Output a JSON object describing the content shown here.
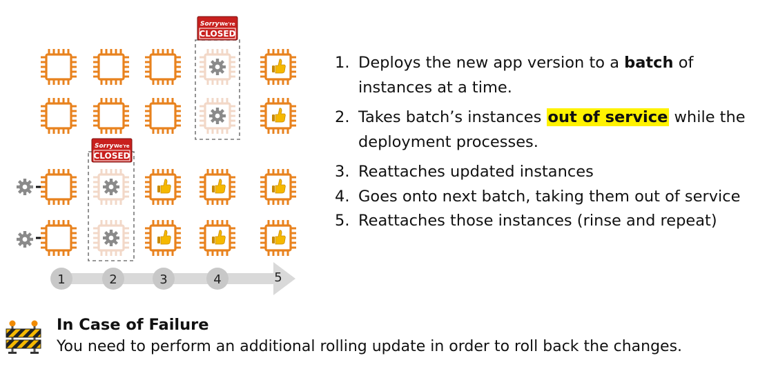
{
  "diagram": {
    "closed_sign_line1": "Sorry",
    "closed_sign_line2": "We're",
    "closed_sign_line3": "CLOSED",
    "timeline_steps": [
      "1",
      "2",
      "3",
      "4",
      "5"
    ],
    "colors": {
      "chip": "#e8821e",
      "chip_faded": "#f2d8c8",
      "gear": "#8a8a8a",
      "thumb": "#f5b800",
      "sign": "#c8201e",
      "timeline": "#d9d9d9"
    }
  },
  "steps": [
    {
      "num": "1.",
      "before": "Deploys the new app version to a ",
      "bold": "batch",
      "after": " of instances at a time."
    },
    {
      "num": "2.",
      "before": "Takes batch’s instances ",
      "highlight": "out of service",
      "after": " while the deployment processes."
    },
    {
      "num": "3.",
      "text": "Reattaches updated instances"
    },
    {
      "num": "4.",
      "text": "Goes onto next batch, taking them out of service"
    },
    {
      "num": "5.",
      "text": "Reattaches those instances (rinse and repeat)"
    }
  ],
  "failure": {
    "title": "In Case of Failure",
    "body": "You need to perform an additional rolling update in order to roll back the changes."
  }
}
